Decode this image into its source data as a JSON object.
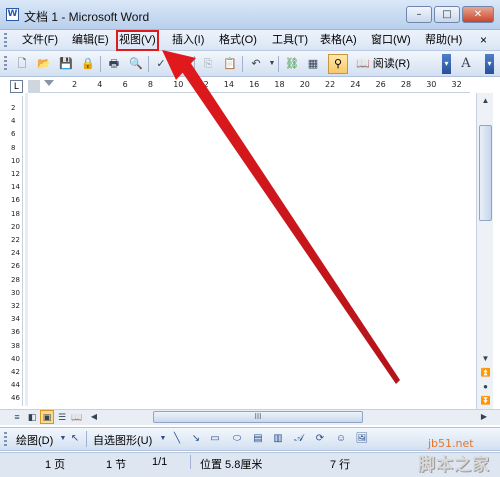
{
  "window": {
    "title": "文档 1 - Microsoft Word",
    "minimize": "–",
    "maximize": "□",
    "close": "✕"
  },
  "menubar": {
    "items": [
      {
        "label": "文件(F)"
      },
      {
        "label": "编辑(E)"
      },
      {
        "label": "视图(V)"
      },
      {
        "label": "插入(I)"
      },
      {
        "label": "格式(O)"
      },
      {
        "label": "工具(T)"
      },
      {
        "label": "表格(A)"
      },
      {
        "label": "窗口(W)"
      },
      {
        "label": "帮助(H)"
      }
    ],
    "highlighted": "视图(V)",
    "close_doc": "×"
  },
  "toolbar": {
    "read_label": "阅读(R)",
    "font_size_label": "A"
  },
  "ruler": {
    "corner": "L",
    "h_ticks": [
      "2",
      "4",
      "6",
      "8",
      "10",
      "12",
      "14",
      "16",
      "18",
      "20",
      "22",
      "24",
      "26",
      "28",
      "30",
      "32"
    ],
    "v_ticks": [
      "2",
      "4",
      "6",
      "8",
      "10",
      "12",
      "14",
      "16",
      "18",
      "20",
      "22",
      "24",
      "26",
      "28",
      "30",
      "32",
      "34",
      "36",
      "38",
      "40",
      "42",
      "44",
      "46"
    ]
  },
  "hscroll": {
    "thumb_grip": "III"
  },
  "drawing_toolbar": {
    "draw_label": "绘图(D)",
    "autoshapes_label": "自选图形(U)"
  },
  "statusbar": {
    "page": "1 页",
    "section": "1 节",
    "page_of": "1/1",
    "position": "位置 5.8厘米",
    "line": "7 行"
  },
  "watermark": {
    "site": "jb51.net",
    "name": "脚本之家"
  },
  "colors": {
    "annotation_red": "#e0191d",
    "watermark_orange": "#e8762a"
  }
}
